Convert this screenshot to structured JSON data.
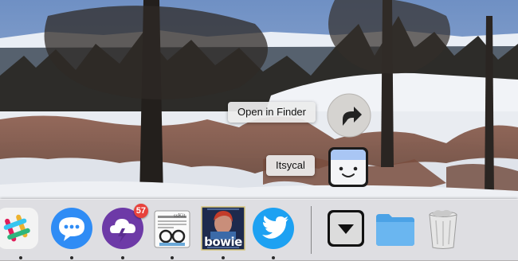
{
  "stack_menu": {
    "open_in_finder_label": "Open in Finder",
    "itsycal_label": "Itsycal"
  },
  "dock": {
    "apps": [
      {
        "name": "Slack",
        "icon": "slack-icon",
        "running": true
      },
      {
        "name": "Messages",
        "icon": "messages-icon",
        "running": true
      },
      {
        "name": "Cloudy",
        "icon": "cloud-bolt-icon",
        "running": true,
        "badge": "57"
      },
      {
        "name": "NewsReader",
        "icon": "newsreader-icon",
        "running": true,
        "icon_text": "ssKit"
      },
      {
        "name": "Bowie",
        "icon": "bowie-album-icon",
        "running": true,
        "icon_text": "bowie"
      },
      {
        "name": "Twitter",
        "icon": "twitter-bird-icon",
        "running": true
      }
    ],
    "stacks": [
      {
        "name": "Downloads stack",
        "icon": "down-arrow-stack-icon"
      },
      {
        "name": "Folder",
        "icon": "folder-icon"
      },
      {
        "name": "Trash",
        "icon": "trash-icon"
      }
    ]
  },
  "colors": {
    "badge": "#e8423c",
    "messages_blue": "#2f8cf5",
    "twitter_blue": "#1da1f2",
    "folder_blue": "#6ab6f0",
    "cloudy_purple": "#6d3aa7"
  }
}
